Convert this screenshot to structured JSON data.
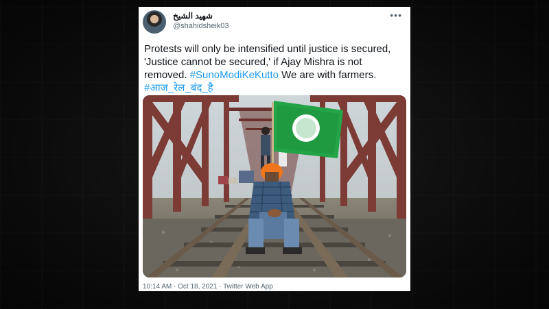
{
  "tweet": {
    "display_name": "شهيد الشيخ",
    "handle": "@shahidsheik03",
    "more_icon": "more-horizontal-icon",
    "text_line1": "Protests will only be intensified until justice is secured,",
    "text_line2": "'Justice cannot be secured,' if Ajay Mishra is not",
    "text_line3_plain": "removed.",
    "hashtag1": "#SunoModiKeKutto",
    "text_line3_tail": "We are with farmers.",
    "hashtag2": "#आज_रेल_बंद_है",
    "timestamp": "10:14 AM · Oct 18, 2021 · Twitter Web App",
    "link_color": "#1d9bf0"
  }
}
